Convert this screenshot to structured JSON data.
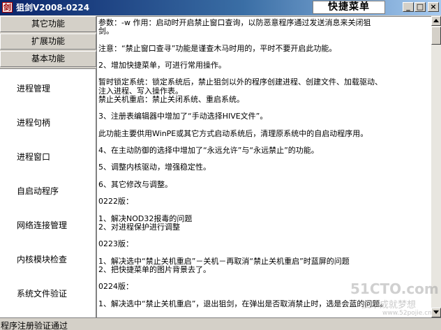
{
  "window": {
    "title": "狙剑V2008-0224",
    "quick_menu_label": "快捷菜单",
    "controls": {
      "minimize": "_",
      "maximize": "□",
      "close": "×"
    }
  },
  "nav": {
    "buttons": [
      "其它功能",
      "扩展功能",
      "基本功能"
    ],
    "items": [
      "进程管理",
      "进程句柄",
      "进程窗口",
      "自启动程序",
      "网络连接管理",
      "内核模块检查",
      "系统文件验证"
    ]
  },
  "content": {
    "lines": [
      "参数：-w      作用：启动时开启禁止窗口查询，以防恶意程序通过发送消息来关闭狙",
      "剑。",
      "",
      "    注意：“禁止窗口查寻”功能是谨查木马时用的，平时不要开启此功能。",
      "",
      "2、增加快捷菜单，可进行常用操作。",
      "",
      "    暂时锁定系统：锁定系统后，禁止狙剑以外的程序创建进程、创建文件、加载驱动、",
      "注入进程、写入操作表。",
      "    禁止关机重启：禁止关闭系统、重启系统。",
      "",
      "3、注册表编辑器中增加了“手动选择HIVE文件”。",
      "",
      "    此功能主要供用WinPE或其它方式启动系统后，清理原系统中的自启动程序用。",
      "",
      "4、在主动防御的选择中增加了“永远允许”与“永远禁止”的功能。",
      "",
      "5、调整内核驱动，增强稳定性。",
      "",
      "6、其它修改与调整。",
      "",
      "0222版：",
      "",
      "1、解决NOD32报毒的问题",
      "2、对进程保护进行调整",
      "",
      "0223版：",
      "",
      "1、解决选中“禁止关机重启”－关机－再取消“禁止关机重启”时蓝屏的问题",
      "2、把快捷菜单的图片背景去了。",
      "",
      "0224版：",
      "",
      "1、解决选中“禁止关机重启”，退出狙剑，在弹出是否取消禁止时，选是会蓝的问题。"
    ]
  },
  "status": {
    "text": "程序注册验证通过"
  },
  "watermark": {
    "big": "51CTO.com",
    "mid": "技术成就梦想",
    "url": "www.52pojie.cn"
  },
  "colors": {
    "titlebar_start": "#0a246a",
    "titlebar_end": "#a6caf0",
    "face": "#d4d0c8",
    "content_bg": "#ffffff"
  },
  "icons": {
    "app": "sword-app-icon",
    "scroll_up": "arrow-up-icon",
    "scroll_down": "arrow-down-icon"
  }
}
